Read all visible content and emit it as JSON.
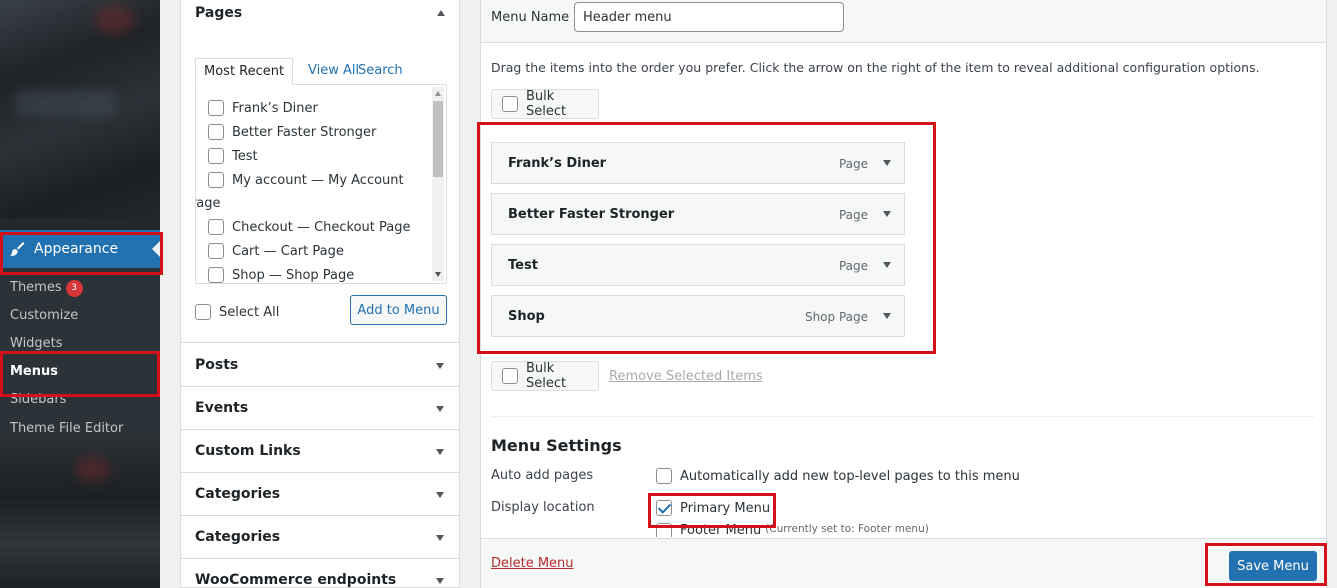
{
  "sidebar": {
    "appearance_label": "Appearance",
    "appearance_icon": "paintbrush-icon",
    "themes_label": "Themes",
    "themes_badge": "3",
    "customize_label": "Customize",
    "widgets_label": "Widgets",
    "menus_label": "Menus",
    "sidebars_label": "Sidebars",
    "theme_file_editor_label": "Theme File Editor",
    "accent_color": "#2271b1"
  },
  "pages_panel": {
    "title": "Pages",
    "tabs": [
      "Most Recent",
      "View All",
      "Search"
    ],
    "pages": [
      "Frank’s Diner",
      "Better Faster Stronger",
      "Test",
      "My account — My Account",
      "Page",
      "Checkout — Checkout Page",
      "Cart — Cart Page",
      "Shop — Shop Page"
    ],
    "select_all_label": "Select All",
    "add_to_menu_label": "Add to Menu"
  },
  "accordion": [
    "Posts",
    "Events",
    "Custom Links",
    "Categories",
    "Categories",
    "WooCommerce endpoints"
  ],
  "menu": {
    "name_label": "Menu Name",
    "name_value": "Header menu",
    "instructions": "Drag the items into the order you prefer. Click the arrow on the right of the item to reveal additional configuration options.",
    "bulk_select_label": "Bulk Select",
    "remove_selected_label": "Remove Selected Items",
    "items": [
      {
        "title": "Frank’s Diner",
        "type": "Page"
      },
      {
        "title": "Better Faster Stronger",
        "type": "Page"
      },
      {
        "title": "Test",
        "type": "Page"
      },
      {
        "title": "Shop",
        "type": "Shop Page"
      }
    ]
  },
  "menu_settings": {
    "title": "Menu Settings",
    "auto_add_label": "Auto add pages",
    "auto_add_option": "Automatically add new top-level pages to this menu",
    "display_location_label": "Display location",
    "primary_menu_label": "Primary Menu",
    "primary_menu_checked": true,
    "footer_menu_label": "Footer Menu",
    "footer_menu_note": "(Currently set to: Footer menu)"
  },
  "footer": {
    "delete_label": "Delete Menu",
    "save_label": "Save Menu"
  },
  "highlight_color": "#d4111b"
}
